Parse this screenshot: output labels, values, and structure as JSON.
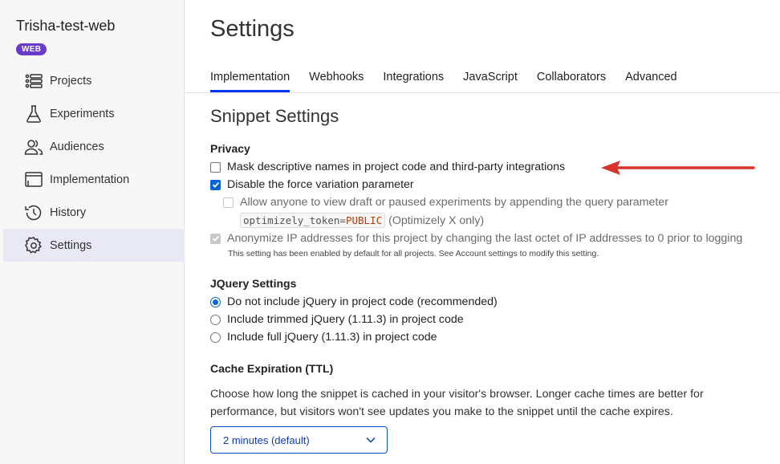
{
  "sidebar": {
    "project_name": "Trisha-test-web",
    "badge": "WEB",
    "items": [
      {
        "label": "Projects",
        "icon": "list-icon"
      },
      {
        "label": "Experiments",
        "icon": "flask-icon"
      },
      {
        "label": "Audiences",
        "icon": "people-icon"
      },
      {
        "label": "Implementation",
        "icon": "window-icon"
      },
      {
        "label": "History",
        "icon": "history-icon"
      },
      {
        "label": "Settings",
        "icon": "gear-icon",
        "active": true
      }
    ]
  },
  "main": {
    "title": "Settings",
    "tabs": [
      {
        "label": "Implementation",
        "active": true
      },
      {
        "label": "Webhooks"
      },
      {
        "label": "Integrations"
      },
      {
        "label": "JavaScript"
      },
      {
        "label": "Collaborators"
      },
      {
        "label": "Advanced"
      }
    ],
    "section_title": "Snippet Settings",
    "privacy": {
      "heading": "Privacy",
      "mask_names": {
        "label": "Mask descriptive names in project code and third-party integrations",
        "checked": false
      },
      "disable_force": {
        "label": "Disable the force variation parameter",
        "checked": true
      },
      "allow_anyone": {
        "label": "Allow anyone to view draft or paused experiments by appending the query parameter",
        "checked": false,
        "disabled": true
      },
      "token_code_prefix": "optimizely_token=",
      "token_code_value": "PUBLIC",
      "token_suffix": "(Optimizely X only)",
      "anonymize_ip": {
        "label": "Anonymize IP addresses for this project by changing the last octet of IP addresses to 0 prior to logging",
        "checked": true,
        "disabled": true
      },
      "anonymize_note": "This setting has been enabled by default for all projects. See Account settings to modify this setting."
    },
    "jquery": {
      "heading": "JQuery Settings",
      "options": [
        {
          "label": "Do not include jQuery in project code (recommended)",
          "selected": true
        },
        {
          "label": "Include trimmed jQuery (1.11.3) in project code",
          "selected": false
        },
        {
          "label": "Include full jQuery (1.11.3) in project code",
          "selected": false
        }
      ]
    },
    "cache": {
      "heading": "Cache Expiration (TTL)",
      "description": "Choose how long the snippet is cached in your visitor's browser. Longer cache times are better for performance, but visitors won't see updates you make to the snippet until the cache expires.",
      "selected": "2 minutes (default)"
    }
  },
  "colors": {
    "accent": "#0037ff",
    "badge": "#6a3bc9",
    "annotation_arrow": "#d9342b"
  }
}
